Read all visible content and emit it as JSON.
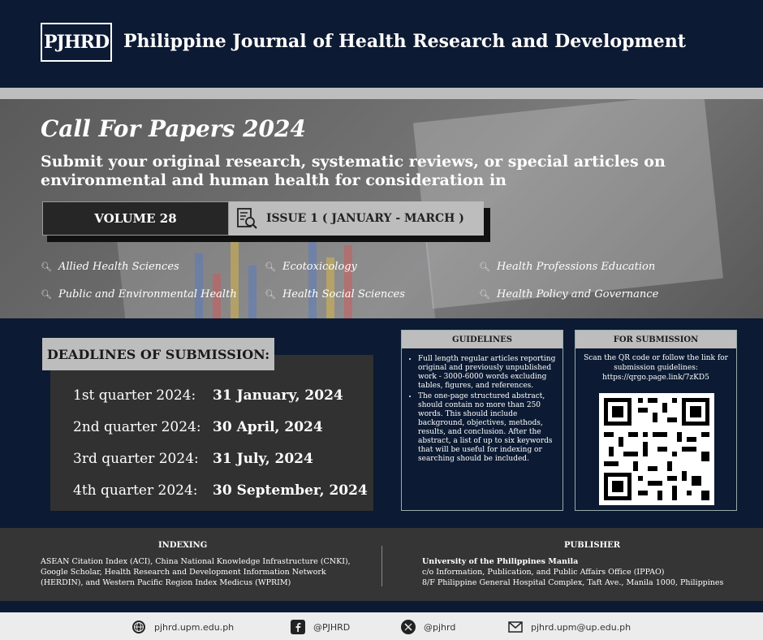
{
  "header": {
    "logo_text": "PJHRD",
    "journal_title": "Philippine Journal of Health Research and Development"
  },
  "hero": {
    "title": "Call For Papers 2024",
    "subtitle": "Submit your original research, systematic reviews, or special articles on environmental and human health for consideration in",
    "volume": "VOLUME 28",
    "issue": "ISSUE 1 ( JANUARY - MARCH )",
    "topics": [
      "Allied Health Sciences",
      "Ecotoxicology",
      "Health Professions Education",
      "Public and Environmental Health",
      "Health Social Sciences",
      "Health Policy and Governance"
    ]
  },
  "deadlines": {
    "heading": "DEADLINES OF SUBMISSION:",
    "rows": [
      {
        "quarter": "1st quarter 2024:",
        "date": "31 January, 2024"
      },
      {
        "quarter": "2nd quarter 2024:",
        "date": "30 April, 2024"
      },
      {
        "quarter": "3rd quarter 2024:",
        "date": "31 July, 2024"
      },
      {
        "quarter": "4th quarter 2024:",
        "date": "30 September, 2024"
      }
    ]
  },
  "guidelines": {
    "heading": "GUIDELINES",
    "items": [
      "Full length regular articles reporting original and previously unpublished work - 3000-6000 words excluding tables, figures, and references.",
      "The one-page structured abstract, should contain no more than 250 words. This should include background, objectives, methods, results, and conclusion. After the abstract, a list of up to six keywords that will be useful for indexing or searching should be included."
    ]
  },
  "submission": {
    "heading": "FOR SUBMISSION",
    "text": "Scan the QR code or follow the link for submission guidelines:",
    "link": "https://qrgo.page.link/7zKD5"
  },
  "indexing": {
    "heading": "INDEXING",
    "text": "ASEAN Citation Index (ACI), China National Knowledge Infrastructure (CNKI), Google Scholar, Health Research and Development Information Network (HERDIN), and Western Pacific Region Index Medicus (WPRIM)"
  },
  "publisher": {
    "heading": "PUBLISHER",
    "name": "University of the Philippines Manila",
    "line1": "c/o Information, Publication, and Public Affairs Office (IPPAO)",
    "line2": "8/F Philippine General Hospital Complex, Taft Ave., Manila 1000, Philippines"
  },
  "contacts": {
    "website": "pjhrd.upm.edu.ph",
    "facebook": "@PJHRD",
    "twitter": "@pjhrd",
    "email": "pjhrd.upm@up.edu.ph"
  }
}
